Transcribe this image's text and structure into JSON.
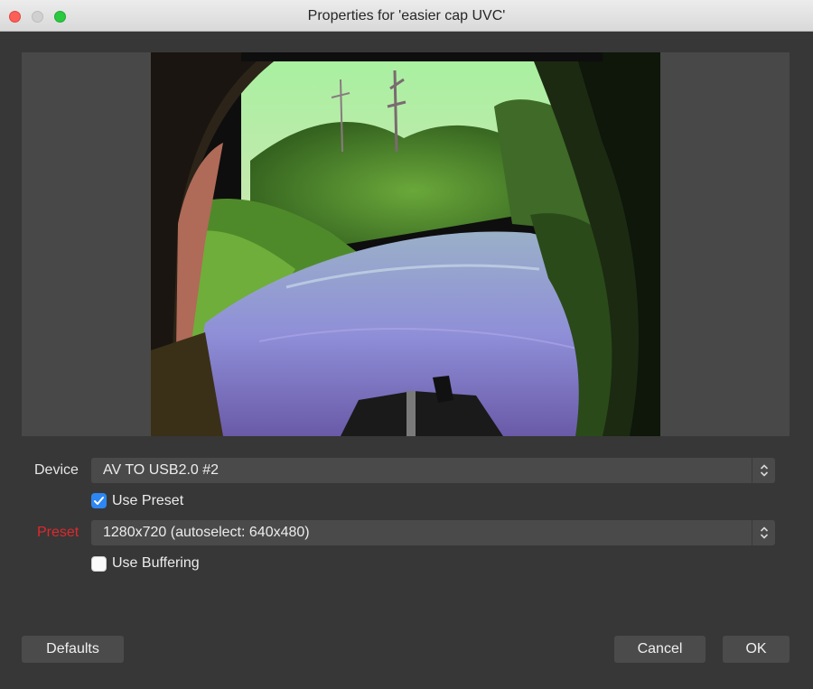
{
  "window": {
    "title": "Properties for 'easier cap UVC'"
  },
  "preview": {
    "description_icon": "video-frame"
  },
  "form": {
    "device_label": "Device",
    "device_value": "AV TO USB2.0 #2",
    "use_preset_label": "Use Preset",
    "use_preset_checked": true,
    "preset_label": "Preset",
    "preset_value": "1280x720 (autoselect: 640x480)",
    "use_buffering_label": "Use Buffering",
    "use_buffering_checked": false
  },
  "buttons": {
    "defaults": "Defaults",
    "cancel": "Cancel",
    "ok": "OK"
  },
  "colors": {
    "accent": "#2d86f2",
    "warning_label": "#e0282c",
    "close": "#fc5f57",
    "zoom": "#2ac940"
  }
}
